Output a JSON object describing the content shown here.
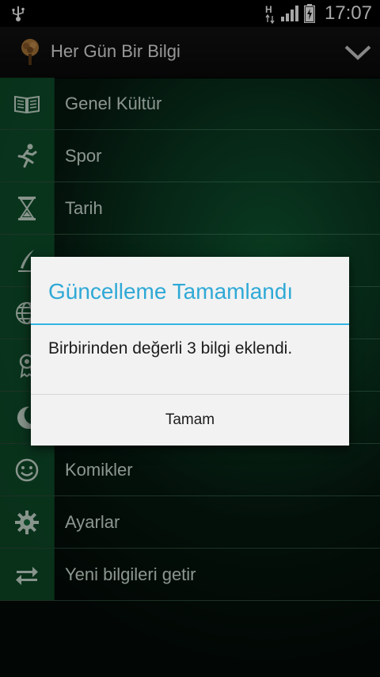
{
  "status_bar": {
    "time": "17:07",
    "icons": [
      "usb-icon",
      "network-h-icon",
      "signal-icon",
      "battery-icon"
    ]
  },
  "app_bar": {
    "title": "Her Gün Bir Bilgi",
    "logo_icon": "tree-logo-icon",
    "menu_icon": "chevron-down-icon"
  },
  "menu": {
    "items": [
      {
        "label": "Genel Kültür",
        "icon": "open-book-icon"
      },
      {
        "label": "Spor",
        "icon": "running-person-icon"
      },
      {
        "label": "Tarih",
        "icon": "hourglass-icon"
      },
      {
        "label": "",
        "icon": "quill-pen-icon"
      },
      {
        "label": "",
        "icon": "globe-icon"
      },
      {
        "label": "",
        "icon": "award-ribbon-icon"
      },
      {
        "label": "",
        "icon": "crescent-moon-icon"
      },
      {
        "label": "Komikler",
        "icon": "smiley-icon"
      },
      {
        "label": "Ayarlar",
        "icon": "gear-icon"
      },
      {
        "label": "Yeni bilgileri getir",
        "icon": "sync-arrows-icon"
      }
    ]
  },
  "dialog": {
    "title": "Güncelleme Tamamlandı",
    "message": "Birbirinden değerli 3 bilgi eklendi.",
    "button_label": "Tamam"
  },
  "colors": {
    "dialog_accent": "#33b5e5",
    "menu_icon_cell": "#146e3c"
  }
}
